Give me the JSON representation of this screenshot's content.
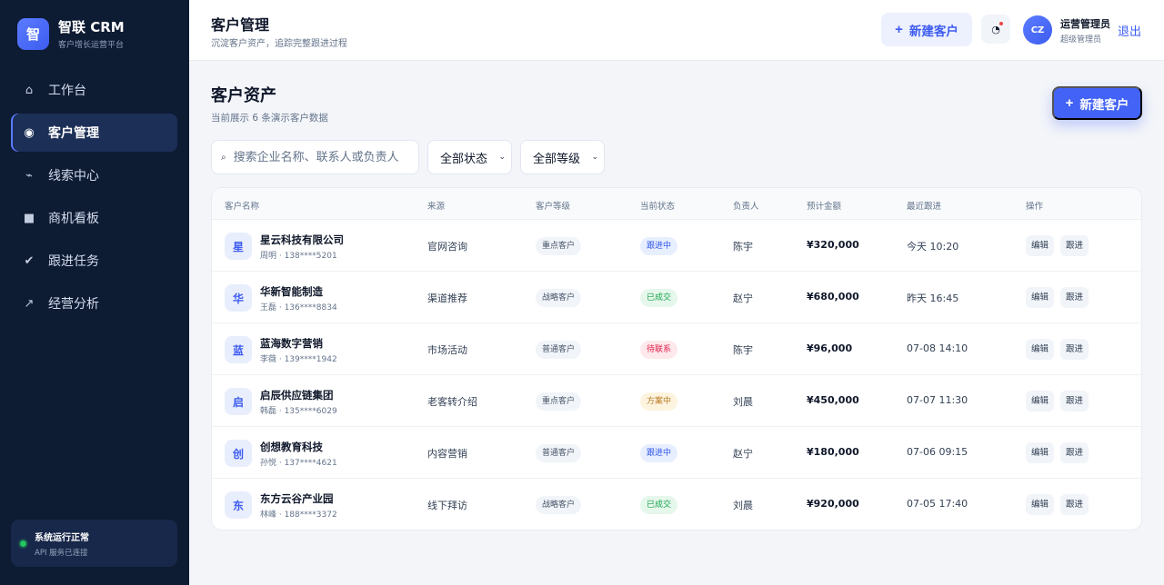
{
  "sidebar": {
    "brand": {
      "logo": "智",
      "name": "智联 CRM",
      "subtitle": "客户增长运营平台"
    },
    "nav": [
      {
        "label": "工作台",
        "icon": "⌂",
        "icon_name": "home-icon"
      },
      {
        "label": "客户管理",
        "icon": "◉",
        "icon_name": "customer-icon",
        "active": true
      },
      {
        "label": "线索中心",
        "icon": "⌁",
        "icon_name": "leads-icon"
      },
      {
        "label": "商机看板",
        "icon": "■",
        "icon_name": "board-icon"
      },
      {
        "label": "跟进任务",
        "icon": "✔",
        "icon_name": "check-icon"
      },
      {
        "label": "经营分析",
        "icon": "↗",
        "icon_name": "trend-icon"
      }
    ],
    "status": {
      "title": "系统运行正常",
      "subtitle": "API 服务已连接"
    }
  },
  "header": {
    "title": "客户管理",
    "subtitle": "沉淀客户资产，追踪完整跟进过程",
    "new_button": "新建客户",
    "user": {
      "initials": "CZ",
      "name": "运营管理员",
      "role": "超级管理员"
    },
    "logout": "退出"
  },
  "main": {
    "title": "客户资产",
    "subtitle": "当前展示 6 条演示客户数据",
    "new_button": "新建客户",
    "search_placeholder": "搜索企业名称、联系人或负责人",
    "filter_status": "全部状态",
    "filter_level": "全部等级"
  },
  "table": {
    "columns": [
      "客户名称",
      "来源",
      "客户等级",
      "当前状态",
      "负责人",
      "预计金额",
      "最近跟进",
      "操作"
    ],
    "rows": [
      {
        "badge": "星",
        "name": "星云科技有限公司",
        "contact": "周明 · 138****5201",
        "source": "官网咨询",
        "level": "重点客户",
        "status": "跟进中",
        "status_type": "following",
        "owner": "陈宇",
        "amount": "¥320,000",
        "last": "今天 10:20",
        "edit": "编辑",
        "follow": "跟进"
      },
      {
        "badge": "华",
        "name": "华新智能制造",
        "contact": "王磊 · 136****8834",
        "source": "渠道推荐",
        "level": "战略客户",
        "status": "已成交",
        "status_type": "done",
        "owner": "赵宁",
        "amount": "¥680,000",
        "last": "昨天 16:45",
        "edit": "编辑",
        "follow": "跟进"
      },
      {
        "badge": "蓝",
        "name": "蓝海数字营销",
        "contact": "李薇 · 139****1942",
        "source": "市场活动",
        "level": "普通客户",
        "status": "待联系",
        "status_type": "pending",
        "owner": "陈宇",
        "amount": "¥96,000",
        "last": "07-08 14:10",
        "edit": "编辑",
        "follow": "跟进"
      },
      {
        "badge": "启",
        "name": "启辰供应链集团",
        "contact": "韩磊 · 135****6029",
        "source": "老客转介绍",
        "level": "重点客户",
        "status": "方案中",
        "status_type": "plan",
        "owner": "刘晨",
        "amount": "¥450,000",
        "last": "07-07 11:30",
        "edit": "编辑",
        "follow": "跟进"
      },
      {
        "badge": "创",
        "name": "创想教育科技",
        "contact": "孙悦 · 137****4621",
        "source": "内容营销",
        "level": "普通客户",
        "status": "跟进中",
        "status_type": "following",
        "owner": "赵宁",
        "amount": "¥180,000",
        "last": "07-06 09:15",
        "edit": "编辑",
        "follow": "跟进"
      },
      {
        "badge": "东",
        "name": "东方云谷产业园",
        "contact": "林峰 · 188****3372",
        "source": "线下拜访",
        "level": "战略客户",
        "status": "已成交",
        "status_type": "done",
        "owner": "刘晨",
        "amount": "¥920,000",
        "last": "07-05 17:40",
        "edit": "编辑",
        "follow": "跟进"
      }
    ]
  },
  "colors": {
    "accent": "#4263f5",
    "sidebar": "#0d1b33",
    "success": "#16a34a",
    "danger": "#e11d48",
    "warning": "#b7791f"
  }
}
